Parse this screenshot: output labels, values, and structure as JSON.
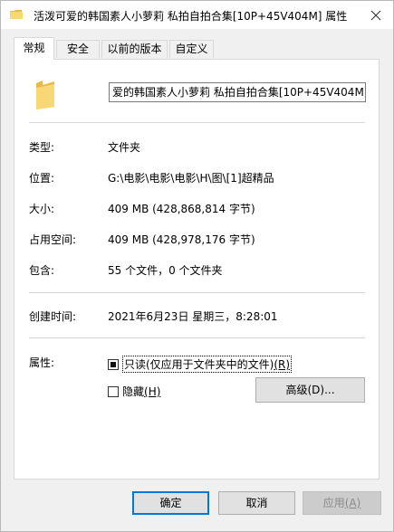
{
  "window": {
    "title": "活泼可爱的韩国素人小萝莉 私拍自拍合集[10P+45V404M] 属性"
  },
  "tabs": [
    {
      "label": "常规",
      "active": true
    },
    {
      "label": "安全",
      "active": false
    },
    {
      "label": "以前的版本",
      "active": false
    },
    {
      "label": "自定义",
      "active": false
    }
  ],
  "general": {
    "name_value": "爱的韩国素人小萝莉 私拍自拍合集[10P+45V404M]",
    "type_label": "类型:",
    "type_value": "文件夹",
    "location_label": "位置:",
    "location_value": "G:\\电影\\电影\\电影\\H\\图\\[1]超精品",
    "size_label": "大小:",
    "size_value": "409 MB (428,868,814 字节)",
    "disk_size_label": "占用空间:",
    "disk_size_value": "409 MB (428,978,176 字节)",
    "contains_label": "包含:",
    "contains_value": "55 个文件，0 个文件夹",
    "created_label": "创建时间:",
    "created_value": "2021年6月23日 星期三，8:28:01",
    "attributes_label": "属性:",
    "readonly_label": "只读(仅应用于文件夹中的文件)",
    "readonly_hotkey": "(R)",
    "hidden_label": "隐藏",
    "hidden_hotkey": "(H)",
    "advanced_label": "高级",
    "advanced_hotkey": "(D)..."
  },
  "buttons": {
    "ok": "确定",
    "cancel": "取消",
    "apply": "应用",
    "apply_hotkey": "(A)"
  },
  "colors": {
    "folder": "#f8d775",
    "accent": "#0078d7"
  }
}
